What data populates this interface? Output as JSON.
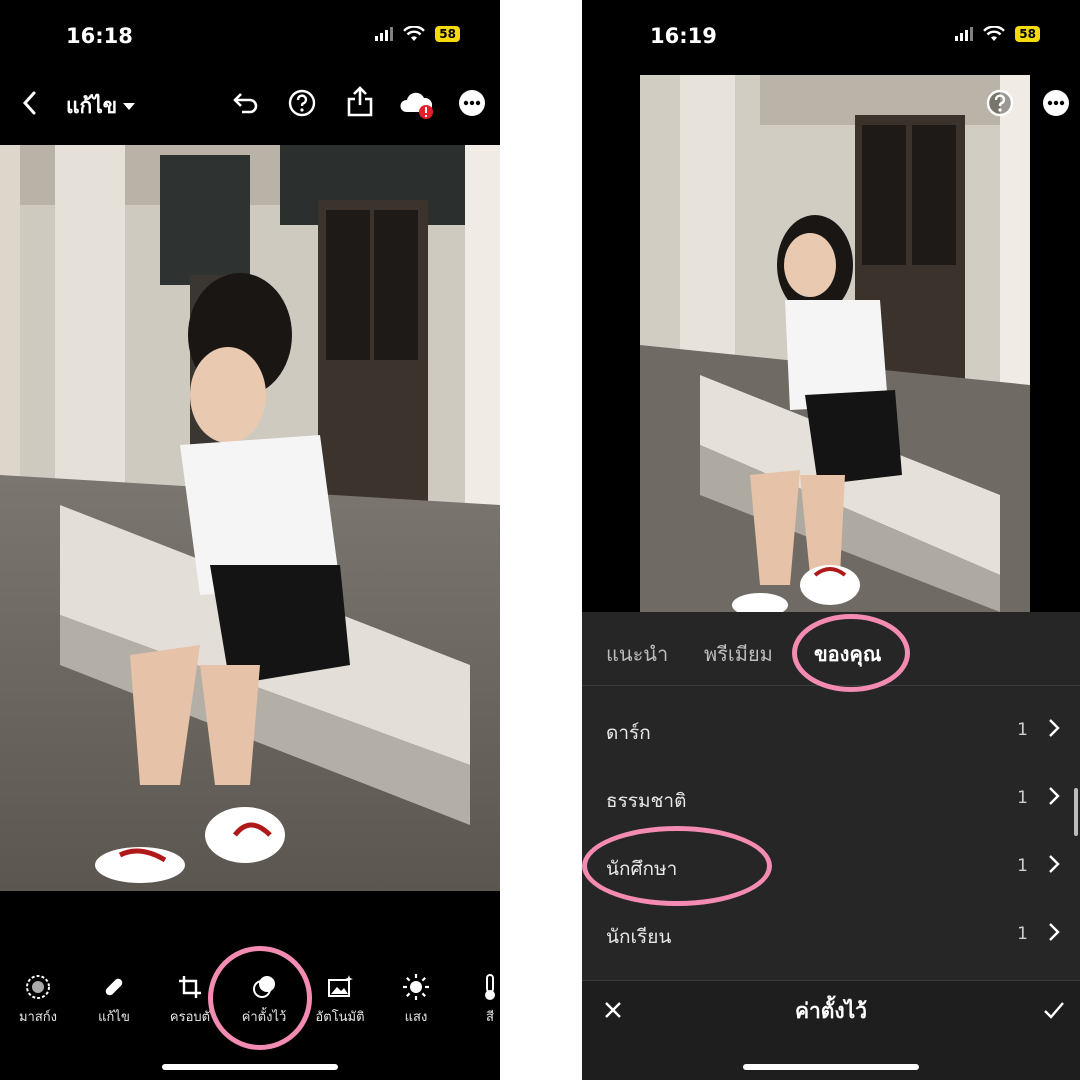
{
  "left_screen": {
    "status": {
      "time": "16:18",
      "battery": "58"
    },
    "header": {
      "title": "แก้ไข"
    },
    "toolbar": [
      {
        "label": "มาสก์ง",
        "icon": "masking-icon"
      },
      {
        "label": "แก้ไข",
        "icon": "bandage-icon"
      },
      {
        "label": "ครอบตั",
        "icon": "crop-icon"
      },
      {
        "label": "ค่าตั้งไว้",
        "icon": "presets-icon"
      },
      {
        "label": "อัตโนมัติ",
        "icon": "auto-icon"
      },
      {
        "label": "แสง",
        "icon": "sun-icon"
      },
      {
        "label": "สี",
        "icon": "thermometer-icon"
      }
    ]
  },
  "right_screen": {
    "status": {
      "time": "16:19",
      "battery": "58"
    },
    "tabs": [
      {
        "label": "แนะนำ",
        "active": false
      },
      {
        "label": "พรีเมียม",
        "active": false
      },
      {
        "label": "ของคุณ",
        "active": true
      }
    ],
    "preset_groups": [
      {
        "name": "ดาร์ก",
        "count": "1"
      },
      {
        "name": "ธรรมชาติ",
        "count": "1"
      },
      {
        "name": "นักศึกษา",
        "count": "1"
      },
      {
        "name": "นักเรียน",
        "count": "1"
      }
    ],
    "bottom_bar": {
      "title": "ค่าตั้งไว้"
    }
  },
  "colors": {
    "highlight": "#f38bb3",
    "panel": "#262626",
    "battery": "#f5d90a",
    "alert": "#e0202a"
  }
}
